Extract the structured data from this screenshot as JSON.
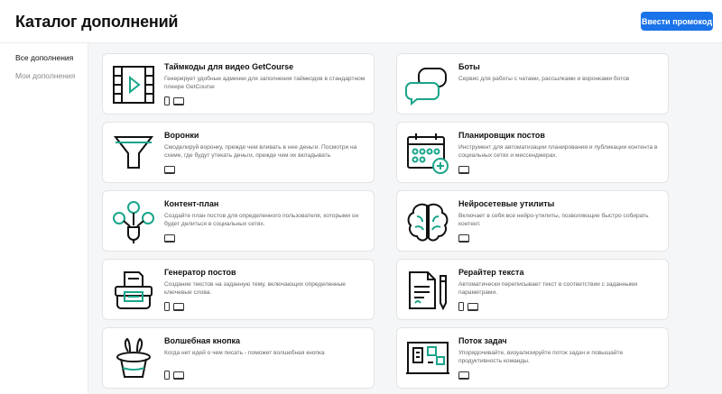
{
  "header": {
    "title": "Каталог дополнений",
    "promo_button": "Ввести промокод"
  },
  "sidebar": {
    "items": [
      {
        "label": "Все дополнения",
        "active": true
      },
      {
        "label": "Мои дополнения",
        "active": false
      }
    ]
  },
  "colors": {
    "accent": "#1a73e8",
    "icon_teal": "#1aa58a",
    "icon_dark": "#111111"
  },
  "cards": [
    {
      "title": "Таймкоды для видео GetCourse",
      "description": "Генерирует удобные админки для заполнения таймкодов в стандартном плеере GetCourse",
      "icon": "video-timecode-icon",
      "devices": [
        "mobile",
        "desktop"
      ]
    },
    {
      "title": "Боты",
      "description": "Сервис для работы с чатами, рассылками и воронками ботов",
      "icon": "chat-bubbles-icon",
      "devices": []
    },
    {
      "title": "Воронки",
      "description": "Смоделируй воронку, прежде чем вливать в нее деньги. Посмотри на схеме, где будут утекать деньги, прежде чем их вкладывать",
      "icon": "funnel-icon",
      "devices": [
        "desktop"
      ]
    },
    {
      "title": "Планировщик постов",
      "description": "Инструмент для автоматизации планирования и публикации контента в социальных сетях и мессенджерах.",
      "icon": "calendar-plus-icon",
      "devices": [
        "desktop"
      ]
    },
    {
      "title": "Контент-план",
      "description": "Создайте план постов для определенного пользователя, которыми он будет делиться в социальных сетях.",
      "icon": "content-plan-icon",
      "devices": [
        "desktop"
      ]
    },
    {
      "title": "Нейросетевые утилиты",
      "description": "Включает в себя все нейро-утилиты, позволяющие быстро собирать контент.",
      "icon": "brain-icon",
      "devices": [
        "desktop"
      ]
    },
    {
      "title": "Генератор постов",
      "description": "Создание текстов на заданную тему, включающих определенные ключевые слова.",
      "icon": "typewriter-icon",
      "devices": [
        "mobile",
        "desktop"
      ]
    },
    {
      "title": "Рерайтер текста",
      "description": "Автоматически переписывает текст в соответствии с заданными параметрами.",
      "icon": "document-pen-icon",
      "devices": [
        "mobile",
        "desktop"
      ]
    },
    {
      "title": "Волшебная кнопка",
      "description": "Когда нет идей о чем писать - поможет волшебная кнопка",
      "icon": "magic-hat-icon",
      "devices": [
        "mobile",
        "desktop"
      ]
    },
    {
      "title": "Поток задач",
      "description": "Упорядочивайте, визуализируйте поток задач и повышайте продуктивность команды.",
      "icon": "task-board-icon",
      "devices": [
        "desktop"
      ]
    }
  ]
}
